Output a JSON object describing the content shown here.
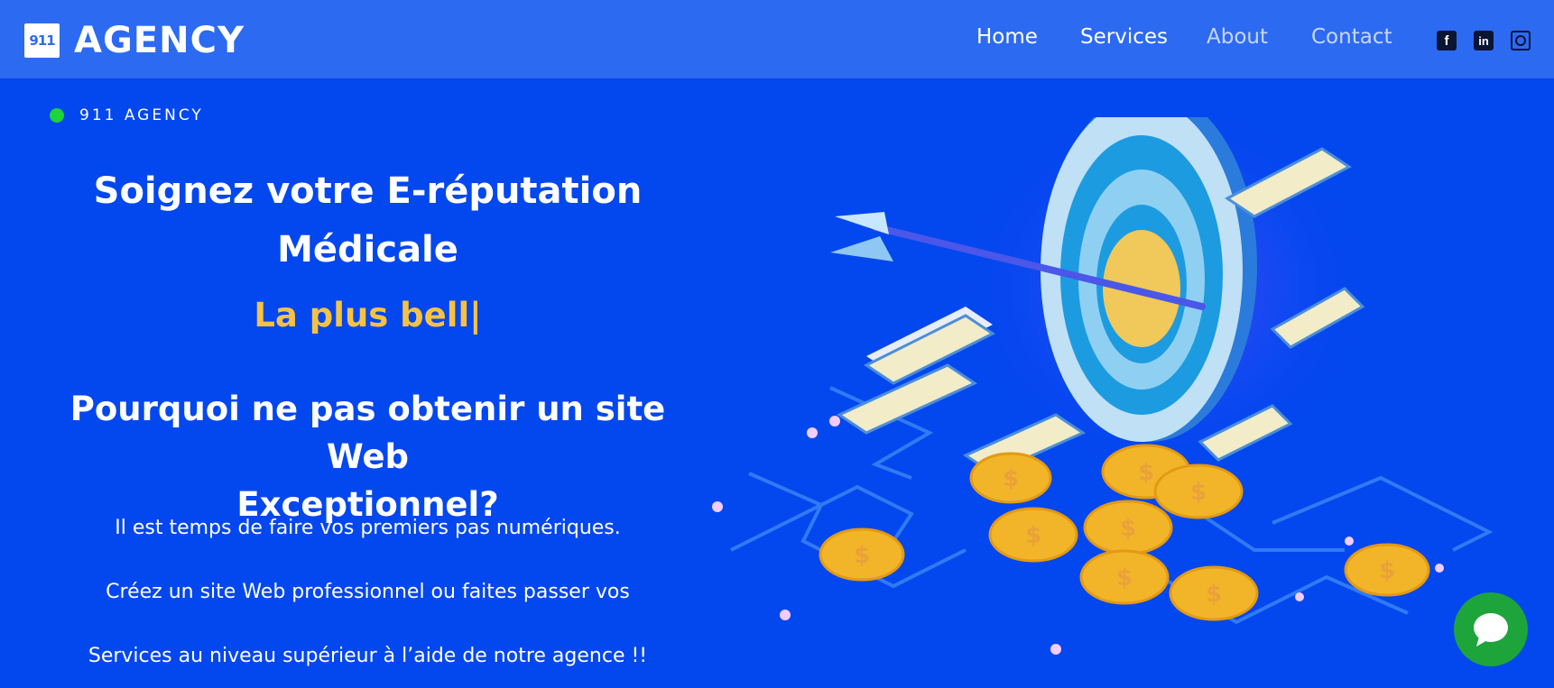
{
  "brand": {
    "logo_badge": "911",
    "name": "AGENCY"
  },
  "nav": {
    "items": [
      {
        "label": "Home"
      },
      {
        "label": "Services"
      },
      {
        "label": "About"
      },
      {
        "label": "Contact"
      }
    ]
  },
  "social": {
    "icons": [
      "facebook-icon",
      "linkedin-icon",
      "instagram-icon"
    ]
  },
  "hero": {
    "eyebrow": "911 AGENCY",
    "title_line1": "Soignez votre E-réputation",
    "title_line2": "Médicale",
    "typed_text": "La plus bell|",
    "subtitle_line1": "Pourquoi ne pas obtenir un site Web",
    "subtitle_line2": "Exceptionnel?",
    "paragraph1": "Il est temps de faire vos premiers pas numériques.",
    "paragraph2": "Créez un site Web professionnel ou faites passer vos",
    "paragraph3": "Services au niveau supérieur à l’aide de notre agence !!"
  },
  "colors": {
    "background": "#0347ef",
    "header": "#2d6af2",
    "accent_yellow": "#f6c244",
    "status_green": "#1fd33a",
    "chat_green": "#1da53b"
  }
}
